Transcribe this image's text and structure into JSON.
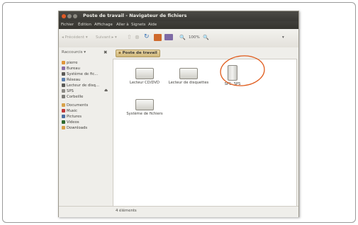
{
  "window": {
    "title": "Poste de travail - Navigateur de fichiers",
    "menu": [
      "Fichier",
      "Édition",
      "Affichage",
      "Aller à",
      "Signets",
      "Aide"
    ],
    "toolbar": {
      "back": "Précédent",
      "forward": "Suivant",
      "zoom": "100%"
    },
    "sidebar_selector": "Raccourcis",
    "breadcrumb": "Poste de travail",
    "sidebar_items": [
      {
        "label": "pierre",
        "icon": "home-icon",
        "color": "#e0963a"
      },
      {
        "label": "Bureau",
        "icon": "desktop-icon",
        "color": "#8a6fa8"
      },
      {
        "label": "Système de fic...",
        "icon": "filesystem-icon",
        "color": "#5c5b57"
      },
      {
        "label": "Réseau",
        "icon": "network-icon",
        "color": "#5b7fae"
      },
      {
        "label": "Lecteur de disq...",
        "icon": "floppy-drive-icon",
        "color": "#5c5b57"
      },
      {
        "label": "SPS",
        "icon": "usb-icon",
        "color": "#8c8b86"
      },
      {
        "label": "Corbeille",
        "icon": "trash-icon",
        "color": "#7d7c78"
      },
      {
        "label": "Documents",
        "icon": "folder-documents-icon",
        "color": "#d8a24a"
      },
      {
        "label": "Music",
        "icon": "folder-music-icon",
        "color": "#c23a3a"
      },
      {
        "label": "Pictures",
        "icon": "folder-pictures-icon",
        "color": "#4d6fa3"
      },
      {
        "label": "Videos",
        "icon": "folder-videos-icon",
        "color": "#2f6a2f"
      },
      {
        "label": "Downloads",
        "icon": "folder-downloads-icon",
        "color": "#d8a24a"
      }
    ],
    "devices": [
      {
        "label": "Lecteur CD/DVD",
        "icon": "cd-drive-icon"
      },
      {
        "label": "Lecteur de disquettes",
        "icon": "floppy-drive-icon"
      },
      {
        "label": "SPS: SPS",
        "icon": "usb-drive-icon"
      },
      {
        "label": "Système de fichiers",
        "icon": "filesystem-icon"
      }
    ],
    "status": "4 éléments"
  },
  "colors": {
    "titlebar": "#3a3935",
    "accent_close": "#e05a26",
    "annotation_circle": "#e05a1a",
    "breadcrumb": "#d8c08a"
  }
}
